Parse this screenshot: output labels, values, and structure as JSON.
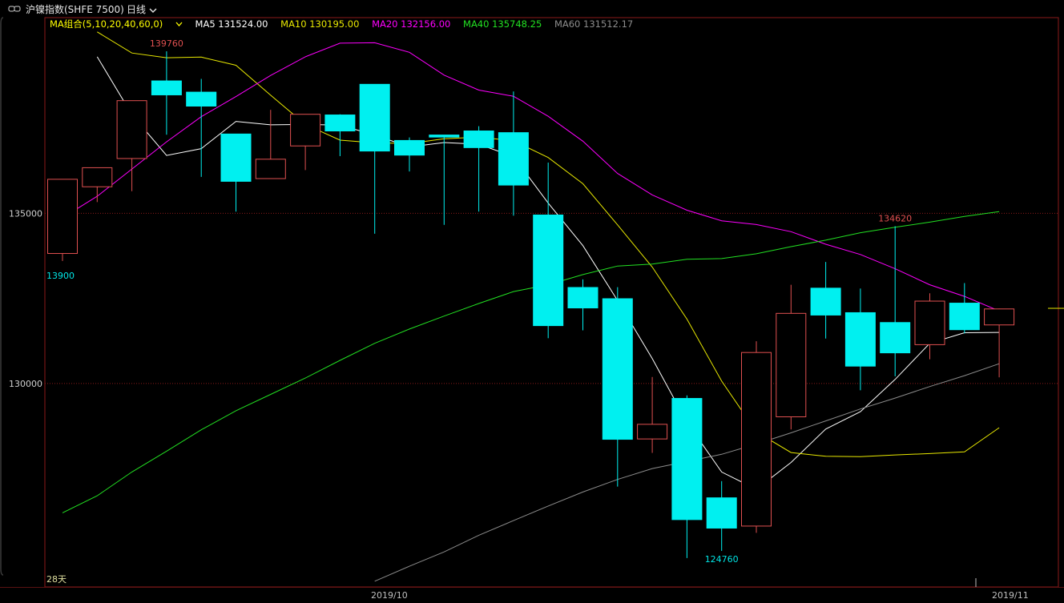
{
  "window": {
    "title": "沪镍指数(SHFE 7500)",
    "period": "日线",
    "period_arrow": "chevron-down-icon"
  },
  "legend": {
    "group": "MA组合(5,10,20,40,60,0)",
    "items": [
      {
        "text": "MA5 131524.00",
        "color": "#ffffff"
      },
      {
        "text": "MA10 130195.00",
        "color": "#ffff00"
      },
      {
        "text": "MA20 132156.00",
        "color": "#ff00ff"
      },
      {
        "text": "MA40 135748.25",
        "color": "#00ff00"
      },
      {
        "text": "MA60 131512.17",
        "color": "#8c8c8c"
      }
    ]
  },
  "footer": {
    "days": "28天",
    "x_labels": [
      "2019/10",
      "2019/11"
    ]
  },
  "chart_data": {
    "type": "candlestick",
    "y_ticks": [
      135000,
      130000
    ],
    "ylim": [
      124020,
      140750
    ],
    "colors": {
      "up": "#e05050",
      "down": "#00f0f0",
      "grid": "#8b1a1a",
      "label_up": "#e05050",
      "label_down": "#00e5e5"
    },
    "candles": [
      {
        "o": 133820,
        "h": 135430,
        "l": 133600,
        "c": 136000
      },
      {
        "o": 135780,
        "h": 136230,
        "l": 135330,
        "c": 136340
      },
      {
        "o": 136610,
        "h": 137710,
        "l": 135650,
        "c": 138310
      },
      {
        "o": 138890,
        "h": 139760,
        "l": 137310,
        "c": 138480
      },
      {
        "o": 138560,
        "h": 138950,
        "l": 136070,
        "c": 138150
      },
      {
        "o": 137330,
        "h": 137330,
        "l": 135050,
        "c": 135940
      },
      {
        "o": 136020,
        "h": 138040,
        "l": 136020,
        "c": 136590
      },
      {
        "o": 136980,
        "h": 137850,
        "l": 136270,
        "c": 137910
      },
      {
        "o": 137890,
        "h": 137910,
        "l": 136680,
        "c": 137420
      },
      {
        "o": 138790,
        "h": 138790,
        "l": 134400,
        "c": 136830
      },
      {
        "o": 137140,
        "h": 137230,
        "l": 136230,
        "c": 136710
      },
      {
        "o": 137300,
        "h": 137300,
        "l": 134660,
        "c": 137240
      },
      {
        "o": 137420,
        "h": 137560,
        "l": 135050,
        "c": 136930
      },
      {
        "o": 137370,
        "h": 138580,
        "l": 134930,
        "c": 135830
      },
      {
        "o": 134950,
        "h": 136490,
        "l": 131330,
        "c": 131700
      },
      {
        "o": 132820,
        "h": 133060,
        "l": 131560,
        "c": 132220
      },
      {
        "o": 132490,
        "h": 132830,
        "l": 126970,
        "c": 128360
      },
      {
        "o": 128370,
        "h": 130190,
        "l": 127960,
        "c": 128800
      },
      {
        "o": 129560,
        "h": 129650,
        "l": 124870,
        "c": 126000
      },
      {
        "o": 126640,
        "h": 127130,
        "l": 125080,
        "c": 125750
      },
      {
        "o": 125810,
        "h": 131240,
        "l": 125610,
        "c": 130910
      },
      {
        "o": 129020,
        "h": 132900,
        "l": 128650,
        "c": 132060
      },
      {
        "o": 132800,
        "h": 133570,
        "l": 131320,
        "c": 132010
      },
      {
        "o": 132080,
        "h": 132790,
        "l": 129800,
        "c": 130510
      },
      {
        "o": 131790,
        "h": 134620,
        "l": 130210,
        "c": 130900
      },
      {
        "o": 131140,
        "h": 132650,
        "l": 130710,
        "c": 132420
      },
      {
        "o": 132360,
        "h": 132950,
        "l": 131470,
        "c": 131580
      },
      {
        "o": 131720,
        "h": 132200,
        "l": 130180,
        "c": 132190
      }
    ],
    "ma": {
      "MA5": [
        null,
        139600,
        137900,
        136700,
        136900,
        137700,
        137600,
        137610,
        137590,
        137300,
        136950,
        137080,
        137030,
        136670,
        135300,
        134050,
        132440,
        130730,
        128860,
        127400,
        126890,
        127680,
        128660,
        129170,
        130120,
        131180,
        131490,
        131500
      ],
      "MA10": [
        null,
        140330,
        139710,
        139570,
        139590,
        139350,
        138470,
        137610,
        137150,
        137070,
        137050,
        137190,
        137240,
        137130,
        136640,
        135870,
        134660,
        133420,
        131890,
        130070,
        128580,
        127970,
        127860,
        127850,
        127900,
        127940,
        127990,
        128700
      ],
      "MA20": [
        134870,
        135500,
        136300,
        137100,
        137840,
        138430,
        139050,
        139600,
        140000,
        140010,
        139730,
        139060,
        138620,
        138440,
        137850,
        137120,
        136170,
        135540,
        135090,
        134780,
        134670,
        134460,
        134090,
        133790,
        133370,
        132900,
        132560,
        132130
      ],
      "MA40": [
        126200,
        126700,
        127400,
        128010,
        128640,
        129200,
        129680,
        130160,
        130680,
        131180,
        131600,
        131980,
        132350,
        132700,
        132900,
        133200,
        133450,
        133510,
        133650,
        133670,
        133810,
        134020,
        134210,
        134430,
        134590,
        134740,
        134910,
        135050
      ],
      "MA60": [
        null,
        null,
        null,
        null,
        null,
        null,
        null,
        null,
        null,
        124190,
        124630,
        125050,
        125540,
        125970,
        126400,
        126810,
        127180,
        127500,
        127710,
        127920,
        128220,
        128550,
        128900,
        129250,
        129570,
        129910,
        130230,
        130580
      ]
    },
    "annotations": [
      {
        "text": "139760",
        "candle": 3,
        "kind": "high"
      },
      {
        "text": "134620",
        "candle": 24,
        "kind": "high"
      },
      {
        "text": "124760",
        "candle": 19,
        "kind": "low"
      },
      {
        "text": "13900",
        "candle": 0,
        "kind": "low"
      }
    ]
  }
}
